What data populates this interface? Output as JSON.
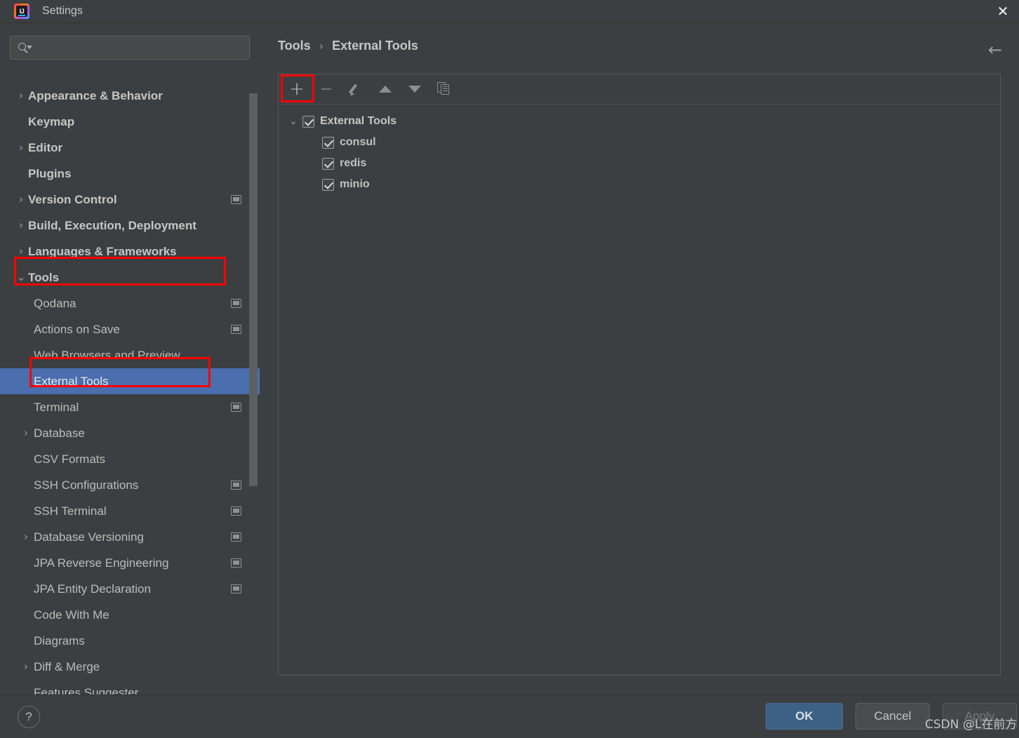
{
  "window": {
    "title": "Settings",
    "logo_text": "IJ",
    "close_icon": "close-icon"
  },
  "search": {
    "value": "",
    "placeholder": ""
  },
  "sidebar": {
    "items": [
      {
        "label": "Appearance & Behavior",
        "level": 0,
        "chevron": "›",
        "scope": false,
        "selected": false
      },
      {
        "label": "Keymap",
        "level": 0,
        "chevron": "",
        "scope": false,
        "selected": false
      },
      {
        "label": "Editor",
        "level": 0,
        "chevron": "›",
        "scope": false,
        "selected": false
      },
      {
        "label": "Plugins",
        "level": 0,
        "chevron": "",
        "scope": false,
        "selected": false
      },
      {
        "label": "Version Control",
        "level": 0,
        "chevron": "›",
        "scope": true,
        "selected": false
      },
      {
        "label": "Build, Execution, Deployment",
        "level": 0,
        "chevron": "›",
        "scope": false,
        "selected": false
      },
      {
        "label": "Languages & Frameworks",
        "level": 0,
        "chevron": "›",
        "scope": false,
        "selected": false
      },
      {
        "label": "Tools",
        "level": 0,
        "chevron": "⌄",
        "scope": false,
        "selected": false
      },
      {
        "label": "Qodana",
        "level": 1,
        "chevron": "",
        "scope": true,
        "selected": false
      },
      {
        "label": "Actions on Save",
        "level": 1,
        "chevron": "",
        "scope": true,
        "selected": false
      },
      {
        "label": "Web Browsers and Preview",
        "level": 1,
        "chevron": "",
        "scope": false,
        "selected": false
      },
      {
        "label": "External Tools",
        "level": 1,
        "chevron": "",
        "scope": false,
        "selected": true
      },
      {
        "label": "Terminal",
        "level": 1,
        "chevron": "",
        "scope": true,
        "selected": false
      },
      {
        "label": "Database",
        "level": 1,
        "chevron": "›",
        "scope": false,
        "selected": false
      },
      {
        "label": "CSV Formats",
        "level": 1,
        "chevron": "",
        "scope": false,
        "selected": false
      },
      {
        "label": "SSH Configurations",
        "level": 1,
        "chevron": "",
        "scope": true,
        "selected": false
      },
      {
        "label": "SSH Terminal",
        "level": 1,
        "chevron": "",
        "scope": true,
        "selected": false
      },
      {
        "label": "Database Versioning",
        "level": 1,
        "chevron": "›",
        "scope": true,
        "selected": false
      },
      {
        "label": "JPA Reverse Engineering",
        "level": 1,
        "chevron": "",
        "scope": true,
        "selected": false
      },
      {
        "label": "JPA Entity Declaration",
        "level": 1,
        "chevron": "",
        "scope": true,
        "selected": false
      },
      {
        "label": "Code With Me",
        "level": 1,
        "chevron": "",
        "scope": false,
        "selected": false
      },
      {
        "label": "Diagrams",
        "level": 1,
        "chevron": "",
        "scope": false,
        "selected": false
      },
      {
        "label": "Diff & Merge",
        "level": 1,
        "chevron": "›",
        "scope": false,
        "selected": false
      },
      {
        "label": "Features Suggester",
        "level": 1,
        "chevron": "",
        "scope": false,
        "selected": false
      }
    ]
  },
  "content": {
    "breadcrumb": {
      "parent": "Tools",
      "separator": "›",
      "current": "External Tools"
    },
    "back_arrow": "←",
    "toolbar": [
      {
        "name": "add-button",
        "glyph": "+",
        "enabled": true,
        "highlighted": true
      },
      {
        "name": "remove-button",
        "glyph": "−",
        "enabled": false,
        "highlighted": false
      },
      {
        "name": "edit-button",
        "glyph": "pencil",
        "enabled": true,
        "highlighted": false
      },
      {
        "name": "move-up-button",
        "glyph": "▲",
        "enabled": true,
        "highlighted": false
      },
      {
        "name": "move-down-button",
        "glyph": "▼",
        "enabled": true,
        "highlighted": false
      },
      {
        "name": "copy-button",
        "glyph": "copy",
        "enabled": true,
        "highlighted": false
      }
    ],
    "tools_tree": {
      "root": {
        "label": "External Tools",
        "checked": true,
        "expanded": true,
        "chevron": "⌄"
      },
      "children": [
        {
          "label": "consul",
          "checked": true
        },
        {
          "label": "redis",
          "checked": true
        },
        {
          "label": "minio",
          "checked": true
        }
      ]
    }
  },
  "footer": {
    "help_label": "?",
    "ok_label": "OK",
    "cancel_label": "Cancel",
    "apply_label": "Apply",
    "watermark": "CSDN @L在前方"
  },
  "colors": {
    "background": "#3c3f41",
    "selection": "#4b6eaf",
    "annotation": "#ff0000",
    "ok_button": "#3d6185",
    "text": "#bbbbbb"
  }
}
